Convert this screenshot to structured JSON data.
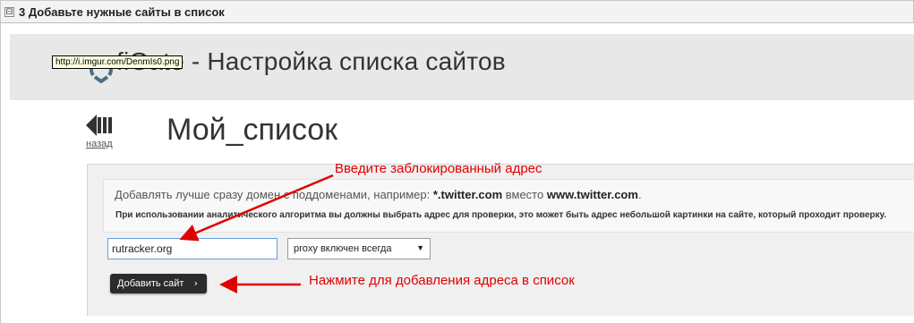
{
  "spoiler": {
    "toggle_symbol": "⊟",
    "title": "3 Добавьте нужные сайты в список"
  },
  "header": {
    "app_title": "fiGate - Настройка списка сайтов",
    "tooltip": "http://i.imgur.com/DenmIs0.png"
  },
  "nav": {
    "back_label": "назад"
  },
  "page": {
    "list_title": "Мой_список"
  },
  "hints": {
    "line1_prefix": "Добавлять лучше сразу домен с поддоменами, например: ",
    "line1_example1": "*.twitter.com",
    "line1_middle": " вместо ",
    "line1_example2": "www.twitter.com",
    "line1_suffix": ".",
    "line2": "При использовании аналитического алгоритма вы должны выбрать адрес для проверки, это может быть адрес небольшой картинки на сайте, который проходит проверку."
  },
  "form": {
    "site_input_value": "rutracker.org",
    "mode_select_value": "proxy включен всегда",
    "add_button_label": "Добавить сайт",
    "add_button_chevron": "›"
  },
  "annotations": {
    "enter_blocked": "Введите заблокированный адрес",
    "press_add": "Нажмите для добавления адреса в список"
  },
  "colors": {
    "annotation_red": "#e00000",
    "button_dark": "#2b2b2b",
    "input_focus_border": "#6a9ed8"
  }
}
